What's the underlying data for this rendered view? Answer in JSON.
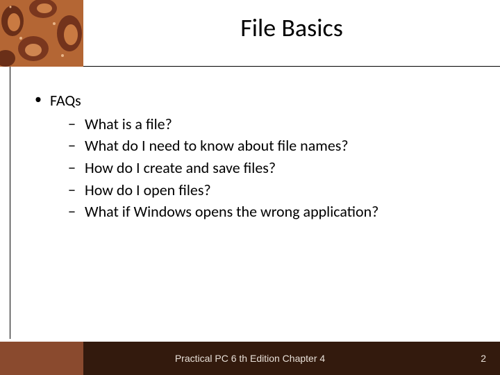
{
  "title": "File Basics",
  "body": {
    "level1": "FAQs",
    "level2": [
      "What is a file?",
      "What do I need to know about file names?",
      "How do I create and save files?",
      "How do I open files?",
      "What if Windows opens the wrong application?"
    ]
  },
  "footer": {
    "text": "Practical PC 6 th Edition Chapter 4",
    "page": "2"
  }
}
